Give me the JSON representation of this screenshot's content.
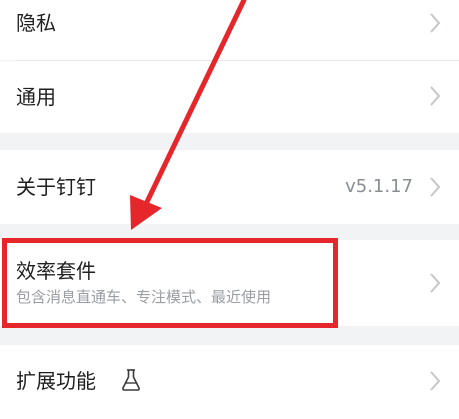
{
  "settings": {
    "privacy_label": "隐私",
    "general_label": "通用",
    "about_label": "关于钉钉",
    "version": "v5.1.17",
    "efficiency_label": "效率套件",
    "efficiency_subtitle": "包含消息直通车、专注模式、最近使用",
    "extensions_label": "扩展功能"
  },
  "icons": {
    "chevron": "chevron-right-icon",
    "lab": "flask-icon"
  },
  "colors": {
    "highlight": "#e5262a",
    "background": "#f2f3f5",
    "row": "#ffffff",
    "text": "#1f1f1f",
    "secondary": "#8a8d93",
    "chevron": "#c4c6ca"
  }
}
